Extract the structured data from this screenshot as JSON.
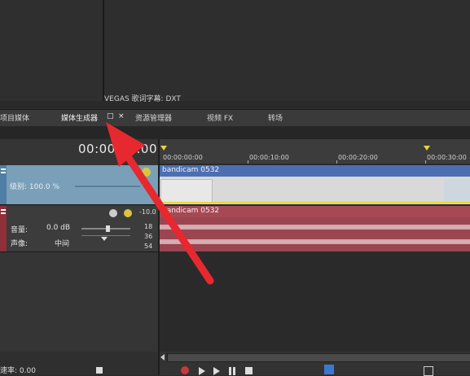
{
  "top": {
    "vegas_subtitle_label": "VEGAS 歌词字幕: DXT"
  },
  "tabs": [
    {
      "label": "项目媒体"
    },
    {
      "label": "媒体生成器"
    },
    {
      "label": "资源管理器"
    },
    {
      "label": "视频 FX"
    },
    {
      "label": "转场"
    }
  ],
  "tab_controls": {
    "restore_icon": "□",
    "close_icon": "×"
  },
  "time_display": "00:00:00:00",
  "ruler": {
    "marks": [
      "00:00:00:00",
      "00:00:10:00",
      "00:00:20:00",
      "00:00:30:00"
    ]
  },
  "video_track": {
    "level_label": "级别: 100.0 %",
    "clip_title": "bandicam 0532"
  },
  "audio_track": {
    "volume_label": "音量:",
    "volume_value": "0.0 dB",
    "pan_label": "声像:",
    "pan_value": "中间",
    "clip_title": "bandicam 0532",
    "meter_labels": [
      "-10.0",
      "18",
      "36",
      "54"
    ]
  },
  "bottom": {
    "rate_label": "速率: 0.00"
  },
  "colors": {
    "video_accent": "#4d6fb2",
    "audio_accent": "#a64955",
    "arrow": "#e8282f"
  }
}
